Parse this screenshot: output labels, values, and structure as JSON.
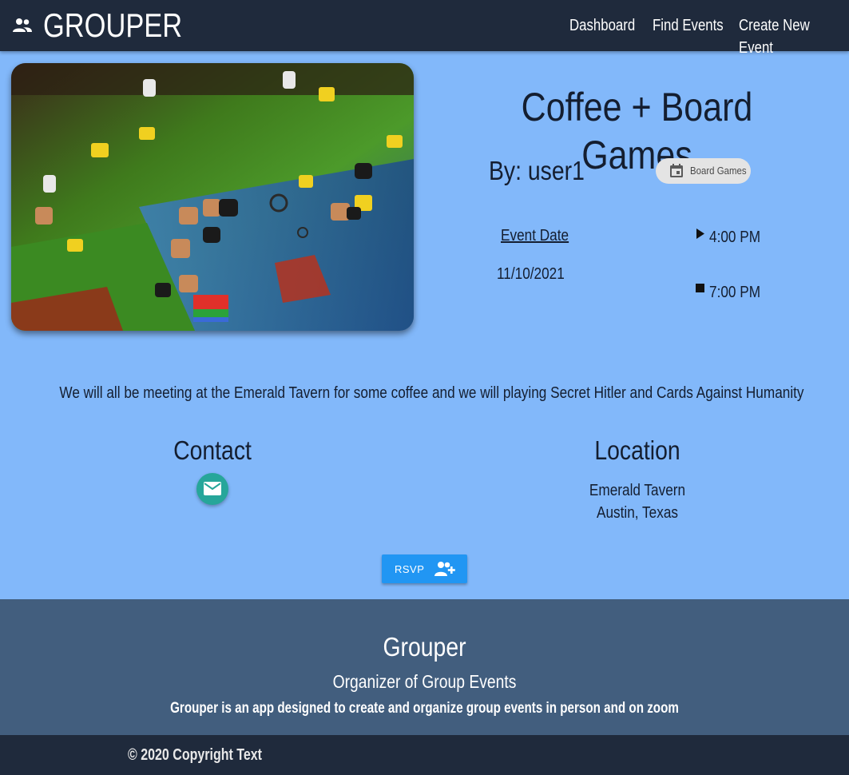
{
  "nav": {
    "brand": "GROUPER",
    "brand_icon": "group-icon",
    "links": [
      "Dashboard",
      "Find Events",
      "Create New Event"
    ]
  },
  "event": {
    "image_icon": "board-game-photo",
    "title": "Coffee + Board Games",
    "by": "By: user1",
    "category": "Board Games",
    "category_icon": "event-icon",
    "date_label": "Event Date",
    "date": "11/10/2021",
    "start_time": "4:00 PM",
    "end_time": "7:00 PM",
    "description": "We will all be meeting at the Emerald Tavern for some coffee and we will playing Secret Hitler and Cards Against Humanity"
  },
  "contact": {
    "heading": "Contact",
    "icon": "email-icon"
  },
  "location": {
    "heading": "Location",
    "line1": "Emerald Tavern",
    "line2": "Austin, Texas"
  },
  "rsvp": {
    "label": "RSVP",
    "icon": "person-add-icon"
  },
  "footer": {
    "title": "Grouper",
    "subtitle": "Organizer of Group Events",
    "description": "Grouper is an app designed to create and organize group events in person and on zoom",
    "copyright": "© 2020 Copyright Text"
  },
  "colors": {
    "nav_bg": "#1f2a3c",
    "page_bg": "#82b8fa",
    "footer_bg": "#425e7e",
    "rsvp_bg": "#2196f3",
    "contact_btn_bg": "#26a69a"
  }
}
